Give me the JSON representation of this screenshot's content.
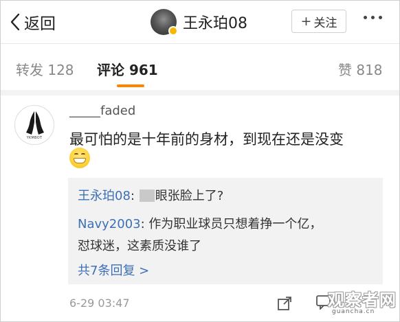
{
  "header": {
    "back_label": "返回",
    "user_name": "王永珀08",
    "follow_label": "关注",
    "follow_icon": "plus-icon",
    "more_icon": "more-dots-icon"
  },
  "tabs": [
    {
      "label": "转发",
      "count": "128",
      "active": false
    },
    {
      "label": "评论",
      "count": "961",
      "active": true
    },
    {
      "label": "赞",
      "count": "818",
      "active": false
    }
  ],
  "colors": {
    "accent_orange": "#ff8200",
    "link_blue": "#3c6fb6",
    "vip_badge": "#f5b800"
  },
  "comment": {
    "user": "_____faded",
    "avatar_brand": "YKMBOT",
    "text": "最可怕的是十年前的身材，到现在还是没变",
    "emoji": "grinning-face-emoji",
    "replies": [
      {
        "user": "王永珀08",
        "sep": ": ",
        "text": "眼张脸上了?"
      },
      {
        "user": "Navy2003",
        "sep": ": ",
        "text": "作为职业球员只想着挣一个亿，",
        "text2": "怼球迷，这素质没谁了"
      }
    ],
    "more_replies_label": "共7条回复 >",
    "timestamp": "6-29 03:47"
  },
  "watermark": {
    "main": "观察者网",
    "sub": "guancha.cn"
  }
}
